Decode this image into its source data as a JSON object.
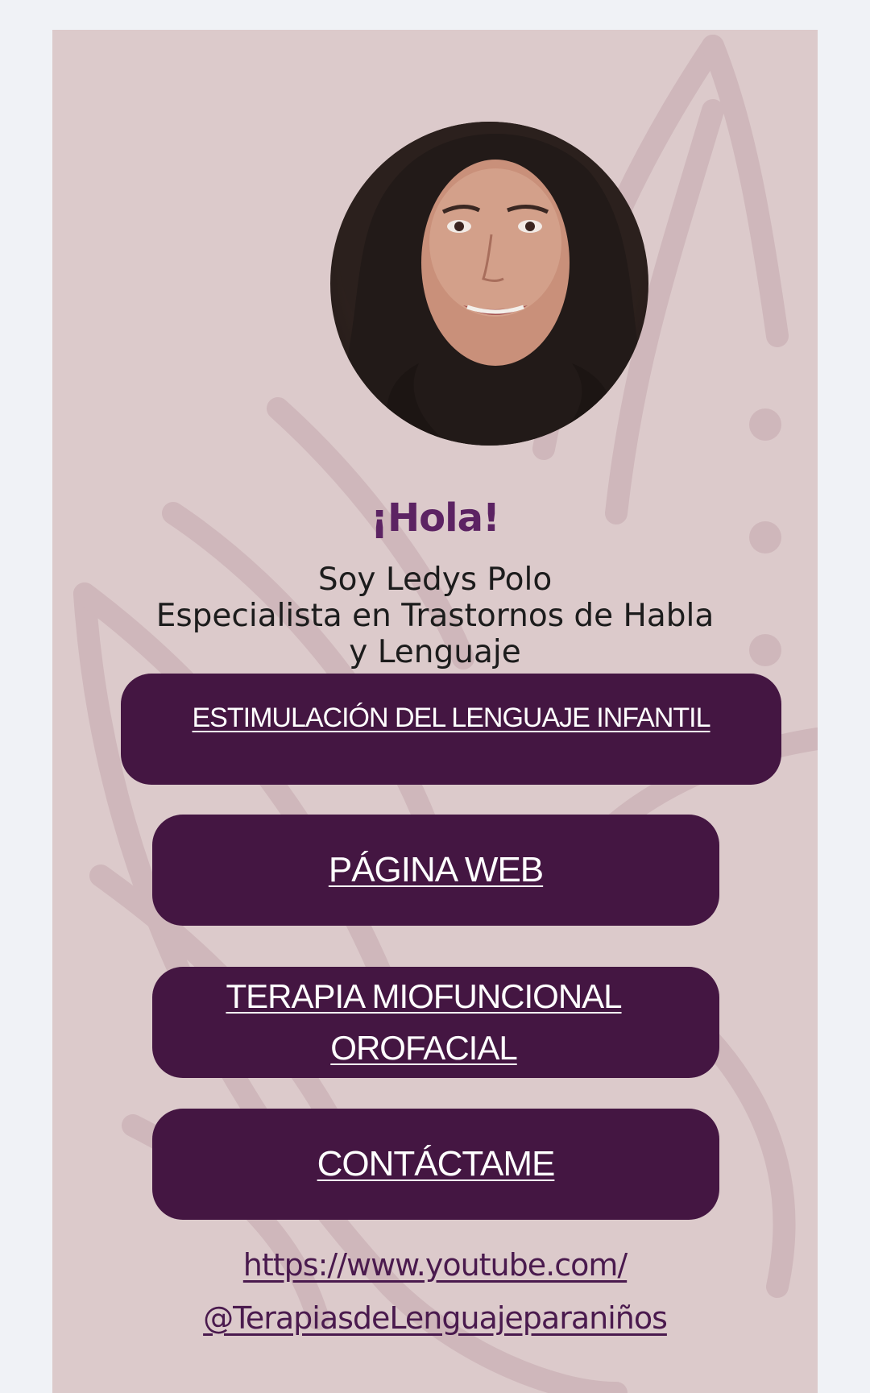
{
  "profile": {
    "greeting": "¡Hola!",
    "intro_line1": "Soy Ledys Polo",
    "intro_line2": "Especialista en Trastornos de Habla",
    "intro_line3": "y Lenguaje"
  },
  "buttons": {
    "stimulation": "ESTIMULACIÓN DEL LENGUAJE INFANTIL",
    "website": "PÁGINA WEB",
    "therapy_line1": "TERAPIA MIOFUNCIONAL",
    "therapy_line2": "OROFACIAL",
    "contact": "CONTÁCTAME"
  },
  "youtube_link": {
    "line1": "https://www.youtube.com/",
    "line2": "@TerapiasdeLenguajeparaniños"
  },
  "colors": {
    "page_background": "#f0f2f6",
    "card_background": "#dccacb",
    "button_background": "#441642",
    "greeting_color": "#5c2363",
    "link_color": "#4a1a4e"
  }
}
